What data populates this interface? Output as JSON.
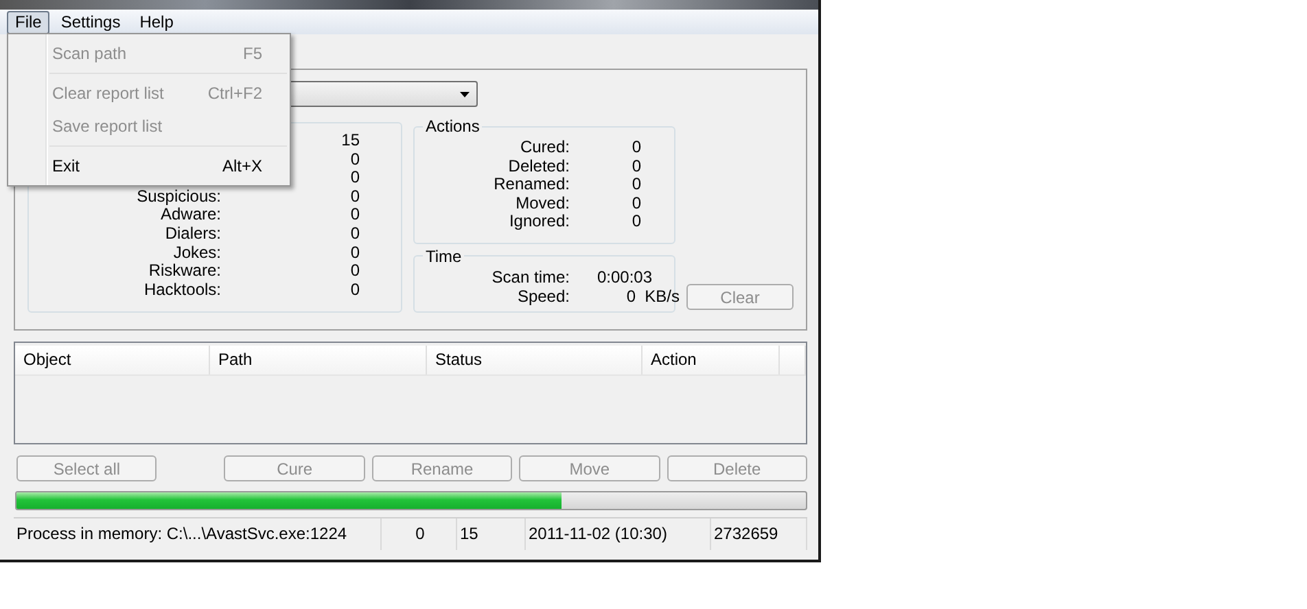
{
  "menu_bar": [
    {
      "label": "File",
      "selected": true
    },
    {
      "label": "Settings",
      "selected": false
    },
    {
      "label": "Help",
      "selected": false
    }
  ],
  "file_menu": [
    {
      "kind": "item",
      "label": "Scan path",
      "shortcut": "F5",
      "disabled": true
    },
    {
      "kind": "separator"
    },
    {
      "kind": "item",
      "label": "Clear report list",
      "shortcut": "Ctrl+F2",
      "disabled": true
    },
    {
      "kind": "item",
      "label": "Save report list",
      "disabled": true
    },
    {
      "kind": "separator"
    },
    {
      "kind": "item",
      "label": "Exit",
      "shortcut": "Alt+X",
      "disabled": false
    }
  ],
  "scan_results": [
    {
      "value": "15"
    },
    {
      "value": "0"
    },
    {
      "value": "0"
    },
    {
      "label": "Suspicious:",
      "value": "0"
    },
    {
      "label": "Adware:",
      "value": "0"
    },
    {
      "label": "Dialers:",
      "value": "0"
    },
    {
      "label": "Jokes:",
      "value": "0"
    },
    {
      "label": "Riskware:",
      "value": "0"
    },
    {
      "label": "Hacktools:",
      "value": "0"
    }
  ],
  "actions": {
    "title": "Actions",
    "rows": [
      {
        "label": "Cured:",
        "value": "0"
      },
      {
        "label": "Deleted:",
        "value": "0"
      },
      {
        "label": "Renamed:",
        "value": "0"
      },
      {
        "label": "Moved:",
        "value": "0"
      },
      {
        "label": "Ignored:",
        "value": "0"
      }
    ]
  },
  "time": {
    "title": "Time",
    "rows": [
      {
        "label": "Scan time:",
        "value": "0:00:03"
      },
      {
        "label": "Speed:",
        "value": "0",
        "unit": "KB/s"
      }
    ]
  },
  "clear_button": {
    "label": "Clear",
    "disabled": true
  },
  "report_table": {
    "columns": [
      "Object",
      "Path",
      "Status",
      "Action"
    ]
  },
  "buttons": [
    {
      "label": "Select all",
      "disabled": true
    },
    {
      "label": "Cure",
      "disabled": true
    },
    {
      "label": "Rename",
      "disabled": true
    },
    {
      "label": "Move",
      "disabled": true
    },
    {
      "label": "Delete",
      "disabled": true
    }
  ],
  "progress": {
    "level": 0.69
  },
  "status_bar": [
    "Process in memory: C:\\...\\AvastSvc.exe:1224",
    "0",
    "15",
    "2011-11-02 (10:30)",
    "2732659"
  ]
}
